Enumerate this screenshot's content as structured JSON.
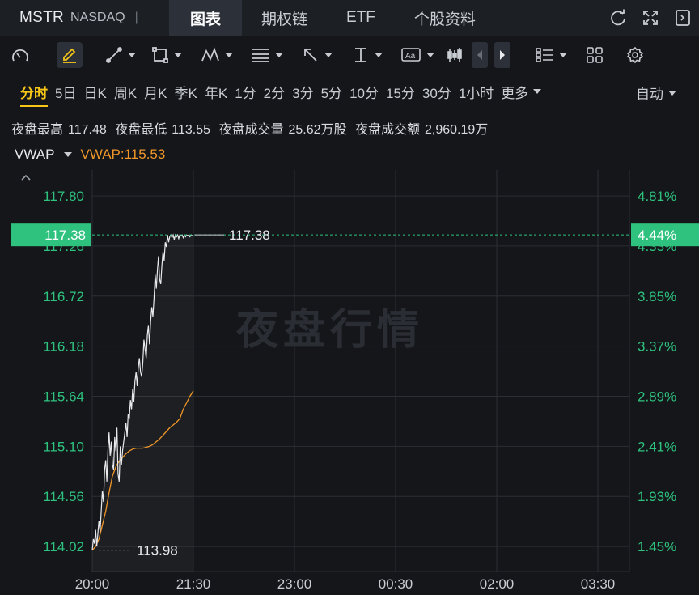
{
  "header": {
    "symbol": "MSTR",
    "market": "NASDAQ",
    "separator": "|",
    "tabs": [
      {
        "label": "图表",
        "active": true
      },
      {
        "label": "期权链",
        "active": false
      },
      {
        "label": "ETF",
        "active": false
      },
      {
        "label": "个股资料",
        "active": false
      }
    ],
    "right_icons": [
      "refresh-icon",
      "fullscreen-icon",
      "collapse-panel-icon"
    ]
  },
  "toolbar": {
    "icons": [
      "gauge-icon",
      "pencil-icon",
      "trend-line-icon",
      "rectangle-icon",
      "pattern-icon",
      "fib-icon",
      "arrow-icon",
      "vertical-line-icon",
      "text-icon",
      "candles-icon",
      "prev-icon",
      "next-icon",
      "list-icon",
      "grid-icon",
      "settings-icon"
    ]
  },
  "periods": {
    "items": [
      "分时",
      "5日",
      "日K",
      "周K",
      "月K",
      "季K",
      "年K",
      "1分",
      "2分",
      "3分",
      "5分",
      "10分",
      "15分",
      "30分",
      "1小时"
    ],
    "active_index": 0,
    "more_label": "更多",
    "auto_label": "自动"
  },
  "stats": {
    "high_label": "夜盘最高",
    "high_value": "117.48",
    "low_label": "夜盘最低",
    "low_value": "113.55",
    "volume_label": "夜盘成交量",
    "volume_value": "25.62万股",
    "turnover_label": "夜盘成交额",
    "turnover_value": "2,960.19万"
  },
  "indicator": {
    "name": "VWAP",
    "value_label": "VWAP:115.53"
  },
  "watermark": "夜盘行情",
  "colors": {
    "background": "#14161a",
    "price_line": "#e8eaed",
    "vwap_line": "#f0962a",
    "axis_green": "#2ec27e",
    "current_tag": "#2ec27e",
    "active_period": "#f5c518"
  },
  "chart_data": {
    "type": "line",
    "x_ticks": [
      "20:00",
      "21:30",
      "23:00",
      "00:30",
      "02:00",
      "03:30"
    ],
    "y_ticks": [
      "117.80",
      "117.26",
      "116.72",
      "116.18",
      "115.64",
      "115.10",
      "114.56",
      "114.02"
    ],
    "y_ticks_right": [
      "4.81%",
      "4.33%",
      "3.85%",
      "3.37%",
      "2.89%",
      "2.41%",
      "1.93%",
      "1.45%"
    ],
    "ylim": [
      113.75,
      118.08
    ],
    "current_price": "117.38",
    "current_change": "4.44%",
    "start_price_label": "113.98",
    "high_label": "117.38",
    "series": [
      {
        "name": "VWAP",
        "x_min": [
          0,
          3,
          6,
          9,
          12,
          15,
          18,
          21,
          24,
          27,
          30,
          33,
          36,
          39,
          42,
          45,
          48,
          51,
          54,
          57,
          60,
          63,
          66,
          69,
          72,
          75,
          78,
          81,
          84,
          87,
          90
        ],
        "values": [
          113.98,
          114.02,
          114.1,
          114.25,
          114.4,
          114.6,
          114.78,
          114.88,
          114.94,
          114.98,
          115.02,
          115.05,
          115.07,
          115.08,
          115.08,
          115.08,
          115.09,
          115.1,
          115.12,
          115.15,
          115.18,
          115.22,
          115.26,
          115.3,
          115.33,
          115.36,
          115.4,
          115.5,
          115.57,
          115.64,
          115.7
        ]
      },
      {
        "name": "价格",
        "x_min": [
          0,
          1,
          2,
          3,
          4,
          5,
          6,
          7,
          8,
          9,
          10,
          11,
          12,
          13,
          14,
          15,
          16,
          17,
          18,
          19,
          20,
          21,
          22,
          23,
          24,
          25,
          26,
          27,
          28,
          29,
          30,
          31,
          32,
          33,
          34,
          35,
          36,
          37,
          38,
          39,
          40,
          41,
          42,
          43,
          44,
          45,
          46,
          47,
          48,
          49,
          50,
          51,
          52,
          53,
          54,
          55,
          56,
          57,
          58,
          59,
          60,
          61,
          62,
          63,
          64,
          65,
          66,
          67,
          68,
          69,
          70,
          71,
          72,
          73,
          74,
          75,
          76,
          77,
          78,
          79,
          80,
          81,
          82,
          83,
          84,
          85,
          86,
          87,
          88,
          89,
          90
        ],
        "values": [
          113.98,
          114.1,
          114.05,
          114.2,
          114.02,
          114.15,
          114.3,
          114.18,
          114.4,
          114.62,
          114.5,
          114.85,
          114.95,
          114.72,
          115.05,
          115.25,
          115.0,
          115.15,
          114.9,
          114.85,
          115.2,
          115.05,
          115.3,
          114.8,
          114.72,
          115.1,
          114.9,
          115.05,
          115.15,
          115.25,
          115.35,
          115.2,
          115.45,
          115.4,
          115.6,
          115.5,
          115.72,
          115.58,
          115.8,
          115.9,
          115.75,
          115.95,
          116.05,
          115.9,
          115.85,
          116.0,
          116.25,
          116.15,
          116.05,
          116.3,
          116.4,
          116.2,
          116.45,
          116.6,
          116.5,
          116.7,
          116.95,
          116.8,
          117.0,
          117.15,
          116.9,
          116.85,
          117.05,
          117.2,
          117.1,
          117.3,
          117.25,
          117.38,
          117.3,
          117.36,
          117.38,
          117.35,
          117.38,
          117.33,
          117.38,
          117.36,
          117.38,
          117.34,
          117.38,
          117.37,
          117.38,
          117.35,
          117.38,
          117.36,
          117.38,
          117.37,
          117.38,
          117.36,
          117.38,
          117.37,
          117.38
        ]
      }
    ],
    "grid": true
  }
}
